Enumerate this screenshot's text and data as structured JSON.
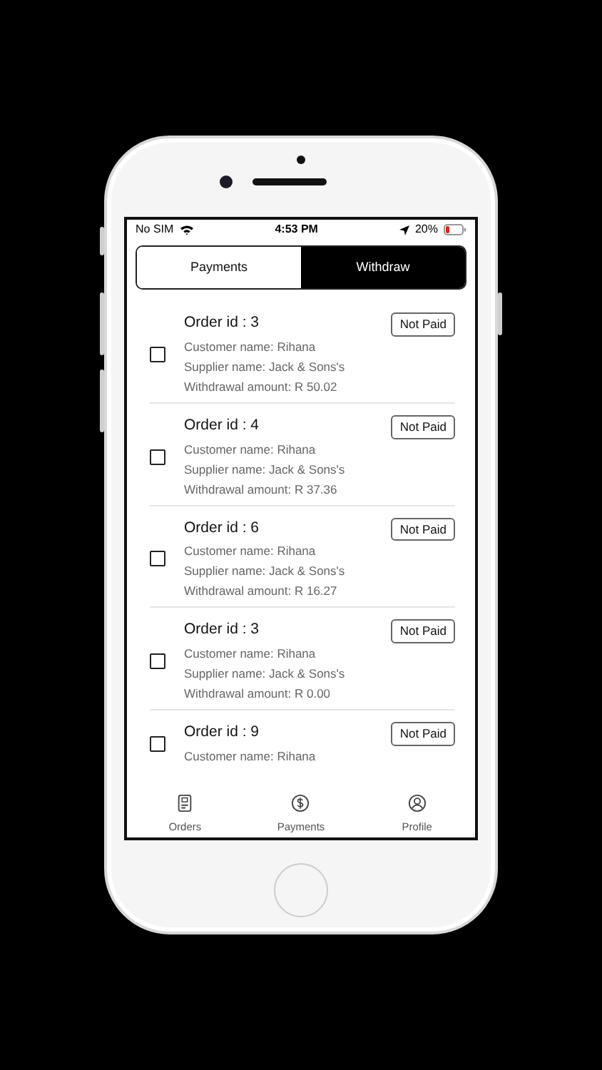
{
  "status_bar": {
    "carrier": "No SIM",
    "time": "4:53 PM",
    "battery": "20%"
  },
  "segments": [
    {
      "label": "Payments",
      "selected": false
    },
    {
      "label": "Withdraw",
      "selected": true
    }
  ],
  "orders": [
    {
      "title": "Order id : 3",
      "checked": false,
      "status": "Not Paid",
      "customer": "Customer name: Rihana",
      "supplier": "Supplier name: Jack & Sons's",
      "amount": "Withdrawal amount: R 50.02"
    },
    {
      "title": "Order id : 4",
      "checked": false,
      "status": "Not Paid",
      "customer": "Customer name: Rihana",
      "supplier": "Supplier name: Jack & Sons's",
      "amount": "Withdrawal amount: R 37.36"
    },
    {
      "title": "Order id : 6",
      "checked": false,
      "status": "Not Paid",
      "customer": "Customer name: Rihana",
      "supplier": "Supplier name: Jack & Sons's",
      "amount": "Withdrawal amount: R 16.27"
    },
    {
      "title": "Order id : 3",
      "checked": false,
      "status": "Not Paid",
      "customer": "Customer name: Rihana",
      "supplier": "Supplier name: Jack & Sons's",
      "amount": "Withdrawal amount: R 0.00"
    },
    {
      "title": "Order id : 9",
      "checked": false,
      "status": "Not Paid",
      "customer": "Customer name: Rihana"
    }
  ],
  "tab_bar": [
    {
      "kind": "orders",
      "label": "Orders",
      "selected": false
    },
    {
      "kind": "payments",
      "label": "Payments",
      "selected": false
    },
    {
      "kind": "profile",
      "label": "Profile",
      "selected": false
    }
  ]
}
